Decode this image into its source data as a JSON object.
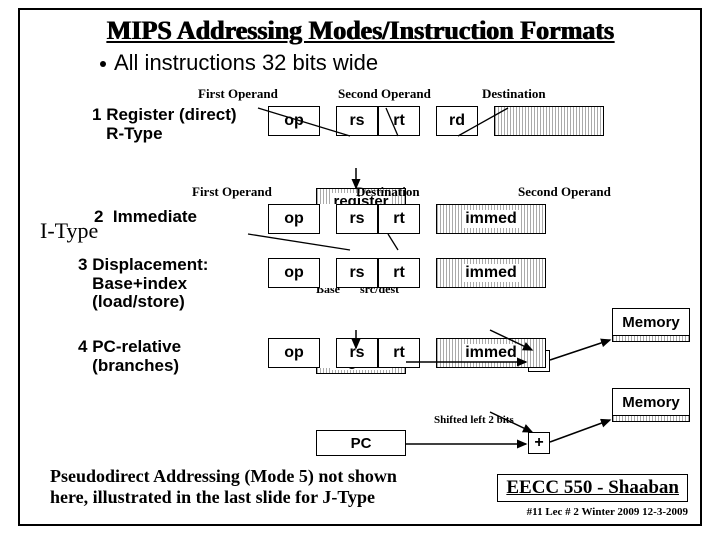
{
  "title": "MIPS Addressing Modes/Instruction Formats",
  "subtitle": "All instructions 32 bits wide",
  "labels": {
    "first_operand": "First Operand",
    "second_operand": "Second Operand",
    "destination": "Destination",
    "base": "Base",
    "src_dest": "src/dest",
    "shifted": "Shifted left 2 bits"
  },
  "side_label": "I-Type",
  "modes": {
    "m1": {
      "num": "1",
      "name": "Register (direct)",
      "sub": "R-Type"
    },
    "m2": {
      "num": "2",
      "name": "Immediate"
    },
    "m3": {
      "num": "3",
      "name": "Displacement:",
      "line2": "Base+index",
      "line3": "(load/store)"
    },
    "m4": {
      "num": "4",
      "name": "PC-relative",
      "line2": "(branches)"
    }
  },
  "fields": {
    "op": "op",
    "rs": "rs",
    "rt": "rt",
    "rd": "rd",
    "immed": "immed",
    "register": "register",
    "pc": "PC",
    "memory": "Memory",
    "plus": "+"
  },
  "note": {
    "line1": "Pseudodirect Addressing (Mode 5) not shown",
    "line2": "here, illustrated in the last slide for J-Type"
  },
  "footer": {
    "course": "EECC 550 - Shaaban",
    "meta": "#11  Lec # 2  Winter 2009  12-3-2009"
  }
}
